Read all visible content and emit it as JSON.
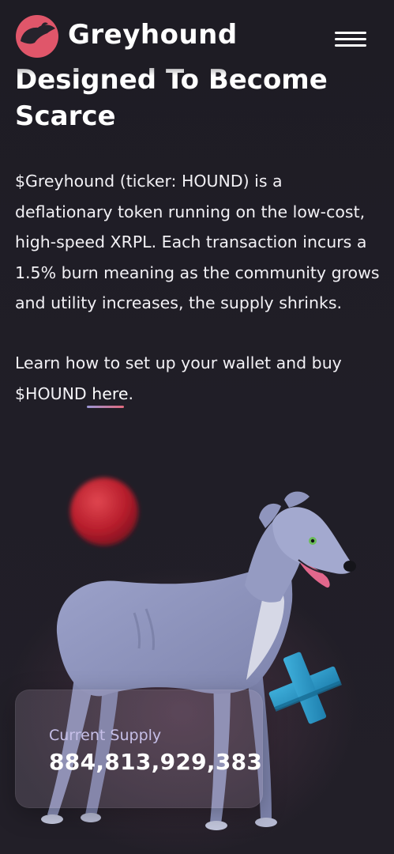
{
  "header": {
    "brand": "Greyhound",
    "logo_icon": "greyhound-logo-icon",
    "menu_icon": "hamburger-menu-icon"
  },
  "section": {
    "heading_line1": "Designed To Become",
    "heading_line2": "Scarce",
    "paragraph": "$Greyhound (ticker: HOUND) is a deflationary token running on the low-cost, high-speed XRPL. Each transaction incurs a 1.5% burn meaning as the community grows and utility increases, the supply shrinks.",
    "learn_text": "Learn how to set up your wallet and buy $HOUND ",
    "learn_link": "here",
    "learn_end": "."
  },
  "supply": {
    "label": "Current Supply",
    "value": "884,813,929,383"
  },
  "colors": {
    "background": "#1f1d26",
    "brand_red": "#e0566a",
    "link_gradient_start": "#9a96d6",
    "link_gradient_end": "#e26a7d",
    "supply_label": "#c6bfe8"
  }
}
